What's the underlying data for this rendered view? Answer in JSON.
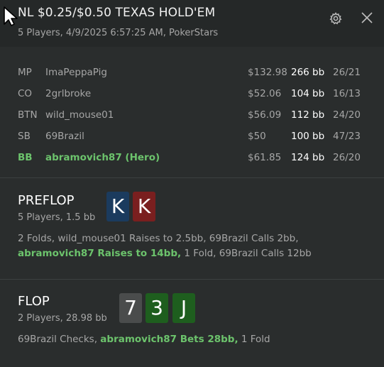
{
  "header": {
    "title": "NL $0.25/$0.50 TEXAS HOLD'EM",
    "subtitle": "5 Players, 4/9/2025 6:57:25 AM, PokerStars"
  },
  "players": [
    {
      "position": "MP",
      "name": "ImaPeppaPig",
      "amount": "$132.98",
      "bb": "266 bb",
      "stats": "26/21",
      "hero": false
    },
    {
      "position": "CO",
      "name": "2grlbroke",
      "amount": "$52.06",
      "bb": "104 bb",
      "stats": "16/13",
      "hero": false
    },
    {
      "position": "BTN",
      "name": "wild_mouse01",
      "amount": "$56.09",
      "bb": "112 bb",
      "stats": "24/20",
      "hero": false
    },
    {
      "position": "SB",
      "name": "69Brazil",
      "amount": "$50",
      "bb": "100 bb",
      "stats": "47/23",
      "hero": false
    },
    {
      "position": "BB",
      "name": "abramovich87 (Hero)",
      "amount": "$61.85",
      "bb": "124 bb",
      "stats": "26/20",
      "hero": true
    }
  ],
  "preflop": {
    "title": "PREFLOP",
    "subtitle": "5 Players, 1.5 bb",
    "cards": [
      {
        "rank": "K",
        "color": "#1b3b5e"
      },
      {
        "rank": "K",
        "color": "#7a1f1f"
      }
    ],
    "action_plain_1": "2 Folds, wild_mouse01 Raises to 2.5bb, 69Brazil Calls 2bb, ",
    "action_hero": "abramovich87 Raises to 14bb,",
    "action_plain_2": " 1 Fold, 69Brazil Calls 12bb"
  },
  "flop": {
    "title": "FLOP",
    "subtitle": "2 Players, 28.98 bb",
    "cards": [
      {
        "rank": "7",
        "color": "#4a4c4c"
      },
      {
        "rank": "3",
        "color": "#1e5e1e"
      },
      {
        "rank": "J",
        "color": "#1e5e1e"
      }
    ],
    "action_plain_1": "69Brazil Checks, ",
    "action_hero": "abramovich87 Bets 28bb,",
    "action_plain_2": " 1 Fold"
  },
  "icons": {
    "settings": "gear-icon",
    "close": "close-icon",
    "cursor": "mouse-cursor-icon"
  },
  "colors": {
    "hero": "#6cc36c",
    "background": "#2a2d2d",
    "header": "#252828"
  }
}
